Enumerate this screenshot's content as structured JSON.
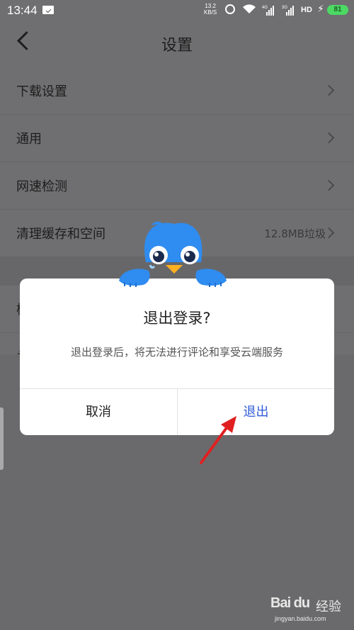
{
  "status_bar": {
    "time": "13:44",
    "net_speed_value": "13.2",
    "net_speed_unit": "KB/S",
    "net_type_1": "4G",
    "net_type_2": "3G",
    "hd_label": "HD",
    "battery": "81"
  },
  "header": {
    "title": "设置"
  },
  "settings": {
    "items": [
      {
        "label": "下载设置"
      },
      {
        "label": "通用"
      },
      {
        "label": "网速检测"
      },
      {
        "label": "清理缓存和空间",
        "value": "12.8MB垃圾"
      }
    ],
    "partial_items": [
      {
        "label": "检"
      },
      {
        "label": "关"
      }
    ]
  },
  "dialog": {
    "title": "退出登录?",
    "message": "退出登录后，将无法进行评论和享受云端服务",
    "cancel_label": "取消",
    "confirm_label": "退出"
  },
  "watermark": {
    "brand": "Bai du",
    "brand_cn": "经验",
    "site": "jingyan.baidu.com"
  },
  "colors": {
    "overlay": "#6f6f71",
    "confirm": "#2f5bd8",
    "arrow": "#e02020",
    "mascot": "#2f8cf0",
    "battery": "#4cd964"
  }
}
